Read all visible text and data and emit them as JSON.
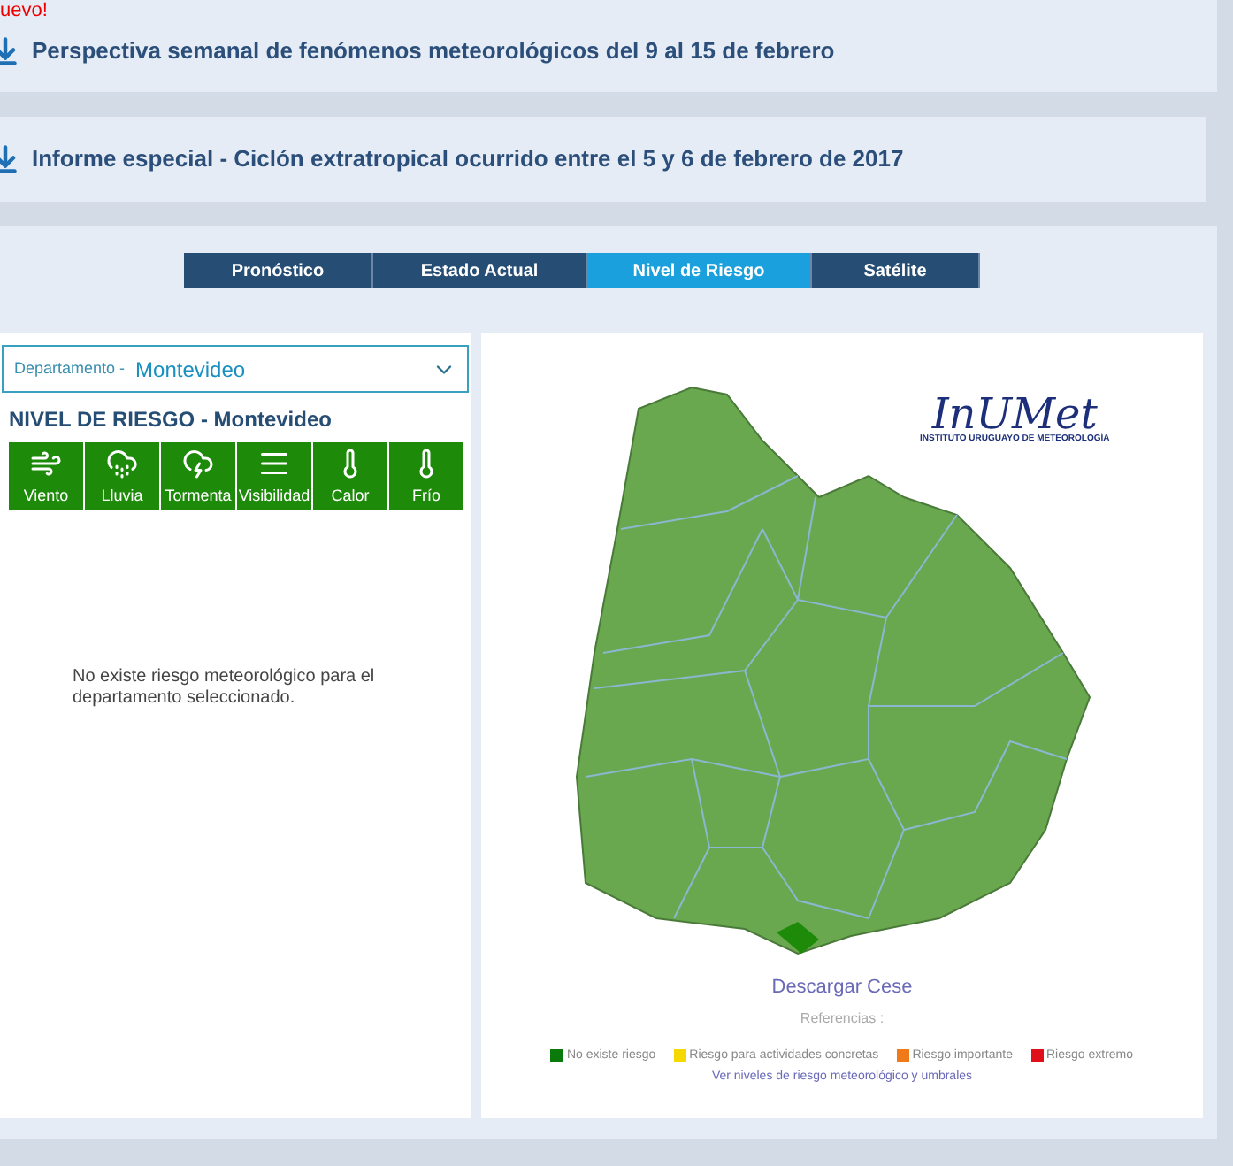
{
  "new_badge": "uevo!",
  "announcements": [
    {
      "title": "Perspectiva semanal de fenómenos meteorológicos del 9 al 15 de febrero"
    },
    {
      "title": "Informe especial - Ciclón extratropical ocurrido entre el 5 y 6 de febrero de 2017"
    }
  ],
  "tabs": [
    {
      "label": "Pronóstico",
      "selected": false
    },
    {
      "label": "Estado Actual",
      "selected": false
    },
    {
      "label": "Nivel de Riesgo",
      "selected": true
    },
    {
      "label": "Satélite",
      "selected": false
    }
  ],
  "department_select": {
    "label": "Departamento -",
    "value": "Montevideo"
  },
  "risk_heading": "NIVEL DE RIESGO - Montevideo",
  "phenomena": [
    {
      "label": "Viento"
    },
    {
      "label": "Lluvia"
    },
    {
      "label": "Tormenta"
    },
    {
      "label": "Visibilidad"
    },
    {
      "label": "Calor"
    },
    {
      "label": "Frío"
    }
  ],
  "message": "No existe riesgo meteorológico para el departamento seleccionado.",
  "logo": {
    "name": "InUMet",
    "subtitle": "INSTITUTO URUGUAYO DE METEOROLOGÍA"
  },
  "download_link": "Descargar Cese",
  "references_label": "Referencias :",
  "legend": [
    {
      "label": "No existe riesgo",
      "color": "#0a7a0a"
    },
    {
      "label": "Riesgo para actividades concretas",
      "color": "#f5d800"
    },
    {
      "label": "Riesgo importante",
      "color": "#f07a1a"
    },
    {
      "label": "Riesgo extremo",
      "color": "#e0101a"
    }
  ],
  "thresholds_link": "Ver niveles de riesgo meteorológico y umbrales"
}
